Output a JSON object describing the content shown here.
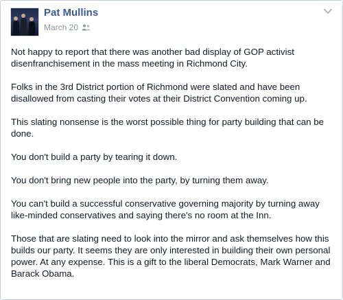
{
  "post": {
    "author_name": "Pat Mullins",
    "date": "March 20",
    "audience_icon": "friends-icon",
    "menu_icon": "chevron-down-icon",
    "paragraphs": [
      "Not happy to report that there was another bad display of GOP activist disenfranchisement in the mass meeting in Richmond City.",
      "Folks in the 3rd District portion of Richmond were slated and have been disallowed from casting their votes at their District Convention coming up.",
      "This slating nonsense is the worst possible thing for party building that can be done.",
      "You don't build a party by tearing it down.",
      "You don't bring new people into the party, by turning them away.",
      "You can't build a successful conservative governing majority by turning away like-minded conservatives and saying there's no room at the Inn.",
      "Those that are slating need to look into the mirror and ask themselves how this builds our party. It seems they are only interested in building their own personal power. At any expense. This is a gift to the liberal Democrats, Mark Warner and Barack Obama."
    ]
  },
  "colors": {
    "link": "#3b5998",
    "meta": "#90949c",
    "text": "#141823",
    "border": "#c4cde0"
  }
}
